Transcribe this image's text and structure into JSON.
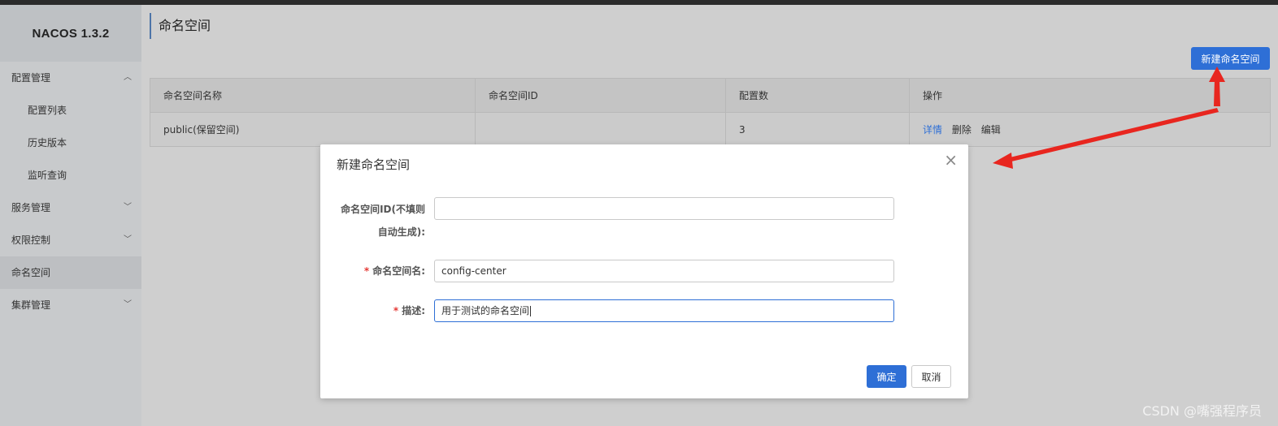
{
  "app": {
    "logo": "NACOS 1.3.2"
  },
  "sidebar": {
    "items": [
      {
        "label": "配置管理",
        "arrow": "chevron-up"
      },
      {
        "label": "配置列表"
      },
      {
        "label": "历史版本"
      },
      {
        "label": "监听查询"
      },
      {
        "label": "服务管理",
        "arrow": "chevron-down"
      },
      {
        "label": "权限控制",
        "arrow": "chevron-down"
      },
      {
        "label": "命名空间",
        "active": true
      },
      {
        "label": "集群管理",
        "arrow": "chevron-down"
      }
    ]
  },
  "main": {
    "title": "命名空间",
    "new_button": "新建命名空间",
    "table": {
      "headers": [
        "命名空间名称",
        "命名空间ID",
        "配置数",
        "操作"
      ],
      "rows": [
        {
          "name": "public(保留空间)",
          "id": "",
          "count": "3",
          "ops": [
            "详情",
            "删除",
            "编辑"
          ]
        }
      ]
    }
  },
  "dialog": {
    "title": "新建命名空间",
    "close_icon": "×",
    "fields": [
      {
        "label_line1": "命名空间ID(不填则",
        "label_line2": "自动生成):",
        "value": "",
        "required": false
      },
      {
        "label": "命名空间名:",
        "value": "config-center",
        "required": true
      },
      {
        "label": "描述:",
        "value": "用于测试的命名空间",
        "required": true,
        "focused": true
      }
    ],
    "required_mark": "*",
    "ok": "确定",
    "cancel": "取消"
  },
  "watermark": "CSDN @嘴强程序员",
  "colors": {
    "accent": "#2e6fd6",
    "annotation_arrow": "#e8261f",
    "required": "#e53935"
  }
}
